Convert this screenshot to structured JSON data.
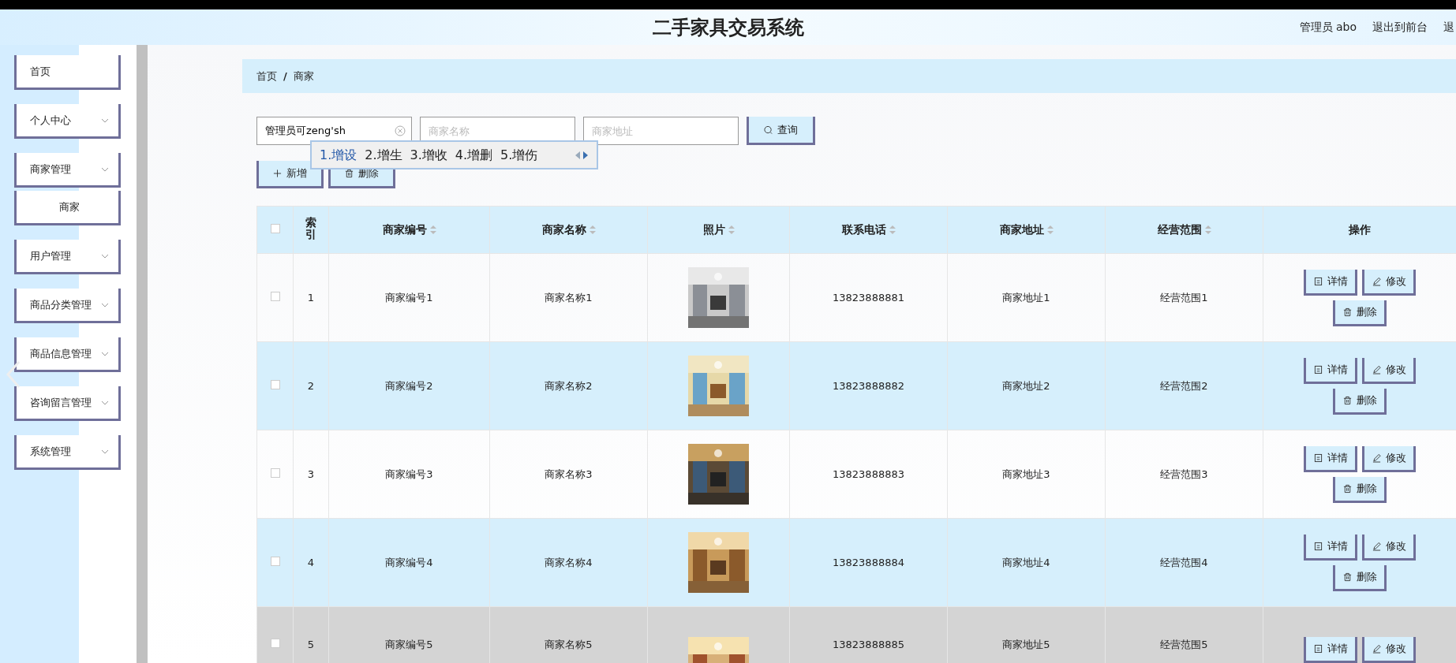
{
  "header": {
    "title": "二手家具交易系统",
    "user": "管理员 abo",
    "links": [
      "退出到前台",
      "退"
    ]
  },
  "sidebar": {
    "items": [
      {
        "label": "首页",
        "expandable": false
      },
      {
        "label": "个人中心",
        "expandable": true
      },
      {
        "label": "商家管理",
        "expandable": true,
        "children": [
          {
            "label": "商家"
          }
        ]
      },
      {
        "label": "用户管理",
        "expandable": true
      },
      {
        "label": "商品分类管理",
        "expandable": true
      },
      {
        "label": "商品信息管理",
        "expandable": true
      },
      {
        "label": "咨询留言管理",
        "expandable": true
      },
      {
        "label": "系统管理",
        "expandable": true
      }
    ]
  },
  "breadcrumb": {
    "items": [
      "首页",
      "商家"
    ],
    "separator": "/"
  },
  "search": {
    "fields": [
      {
        "value": "管理员可zeng'sh",
        "clearable": true
      },
      {
        "placeholder": "商家名称",
        "clearable": false
      },
      {
        "placeholder": "商家地址",
        "clearable": false
      }
    ],
    "button": "查询"
  },
  "ime": {
    "candidates": [
      {
        "label": "1.增设",
        "selected": true
      },
      {
        "label": "2.增生",
        "selected": false
      },
      {
        "label": "3.增收",
        "selected": false
      },
      {
        "label": "4.增删",
        "selected": false
      },
      {
        "label": "5.增伤",
        "selected": false
      }
    ]
  },
  "toolbar": [
    {
      "label": "新增",
      "kind": "add"
    },
    {
      "label": "删除",
      "kind": "delete"
    }
  ],
  "table": {
    "select_all_checked": false,
    "columns": [
      {
        "label": "索引",
        "sortable": false
      },
      {
        "label": "商家编号",
        "sortable": true
      },
      {
        "label": "商家名称",
        "sortable": true
      },
      {
        "label": "照片",
        "sortable": true
      },
      {
        "label": "联系电话",
        "sortable": true
      },
      {
        "label": "商家地址",
        "sortable": true
      },
      {
        "label": "经营范围",
        "sortable": true
      },
      {
        "label": "操作",
        "sortable": false
      }
    ],
    "rows": [
      {
        "checked": false,
        "index": "1",
        "id": "商家编号1",
        "name": "商家名称1",
        "photo": {
          "kind": "picture"
        },
        "phone": "13823888881",
        "address": "商家地址1",
        "scope": "经营范围1",
        "actions": [
          {
            "label": "详情",
            "kind": "detail"
          },
          {
            "label": "修改",
            "kind": "edit"
          },
          {
            "label": "删除",
            "kind": "delete"
          }
        ]
      },
      {
        "checked": false,
        "index": "2",
        "id": "商家编号2",
        "name": "商家名称2",
        "photo": {
          "kind": "picture"
        },
        "phone": "13823888882",
        "address": "商家地址2",
        "scope": "经营范围2",
        "actions": [
          {
            "label": "详情",
            "kind": "detail"
          },
          {
            "label": "修改",
            "kind": "edit"
          },
          {
            "label": "删除",
            "kind": "delete"
          }
        ]
      },
      {
        "checked": false,
        "index": "3",
        "id": "商家编号3",
        "name": "商家名称3",
        "photo": {
          "kind": "picture"
        },
        "phone": "13823888883",
        "address": "商家地址3",
        "scope": "经营范围3",
        "actions": [
          {
            "label": "详情",
            "kind": "detail"
          },
          {
            "label": "修改",
            "kind": "edit"
          },
          {
            "label": "删除",
            "kind": "delete"
          }
        ]
      },
      {
        "checked": false,
        "index": "4",
        "id": "商家编号4",
        "name": "商家名称4",
        "photo": {
          "kind": "picture"
        },
        "phone": "13823888884",
        "address": "商家地址4",
        "scope": "经营范围4",
        "actions": [
          {
            "label": "详情",
            "kind": "detail"
          },
          {
            "label": "修改",
            "kind": "edit"
          },
          {
            "label": "删除",
            "kind": "delete"
          }
        ]
      },
      {
        "checked": false,
        "index": "5",
        "id": "商家编号5",
        "name": "商家名称5",
        "photo": {
          "kind": "picture"
        },
        "phone": "13823888885",
        "address": "商家地址5",
        "scope": "经营范围5",
        "actions": [
          {
            "label": "详情",
            "kind": "detail"
          },
          {
            "label": "修改",
            "kind": "edit"
          }
        ]
      }
    ]
  }
}
